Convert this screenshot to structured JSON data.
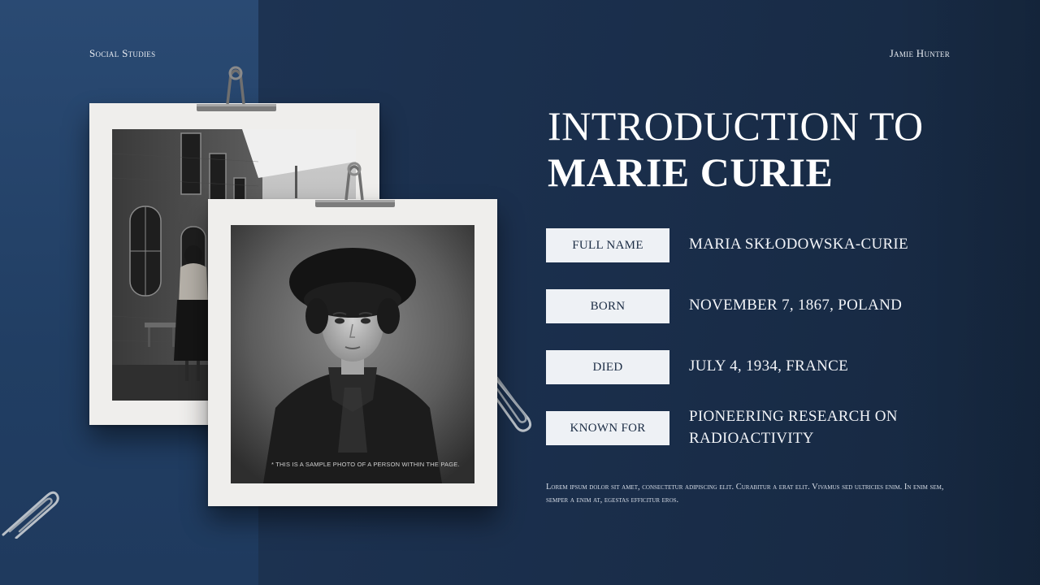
{
  "header": {
    "subject": "Social Studies",
    "author": "Jamie Hunter"
  },
  "title": {
    "line1": "INTRODUCTION TO",
    "line2": "MARIE CURIE"
  },
  "info": [
    {
      "label": "FULL NAME",
      "value": "MARIA SKŁODOWSKA-CURIE"
    },
    {
      "label": "BORN",
      "value": "NOVEMBER 7, 1867, POLAND"
    },
    {
      "label": "DIED",
      "value": "JULY 4, 1934, FRANCE"
    },
    {
      "label": "KNOWN FOR",
      "value": "PIONEERING RESEARCH ON RADIOACTIVITY"
    }
  ],
  "body": "Lorem ipsum dolor sit amet, consectetur adipiscing elit. Curabitur a erat elit. Vivamus sed ultricies enim. In enim sem, semper a enim at, egestas efficitur eros.",
  "photo_caption": "* THIS IS A SAMPLE PHOTO OF A PERSON WITHIN THE PAGE.",
  "colors": {
    "background": "#1b2f4a",
    "left_panel": "#2a4a73",
    "label_box": "#eef1f5",
    "frame": "#efeeec"
  },
  "icons": [
    "binder-clip-icon",
    "paperclip-icon"
  ]
}
